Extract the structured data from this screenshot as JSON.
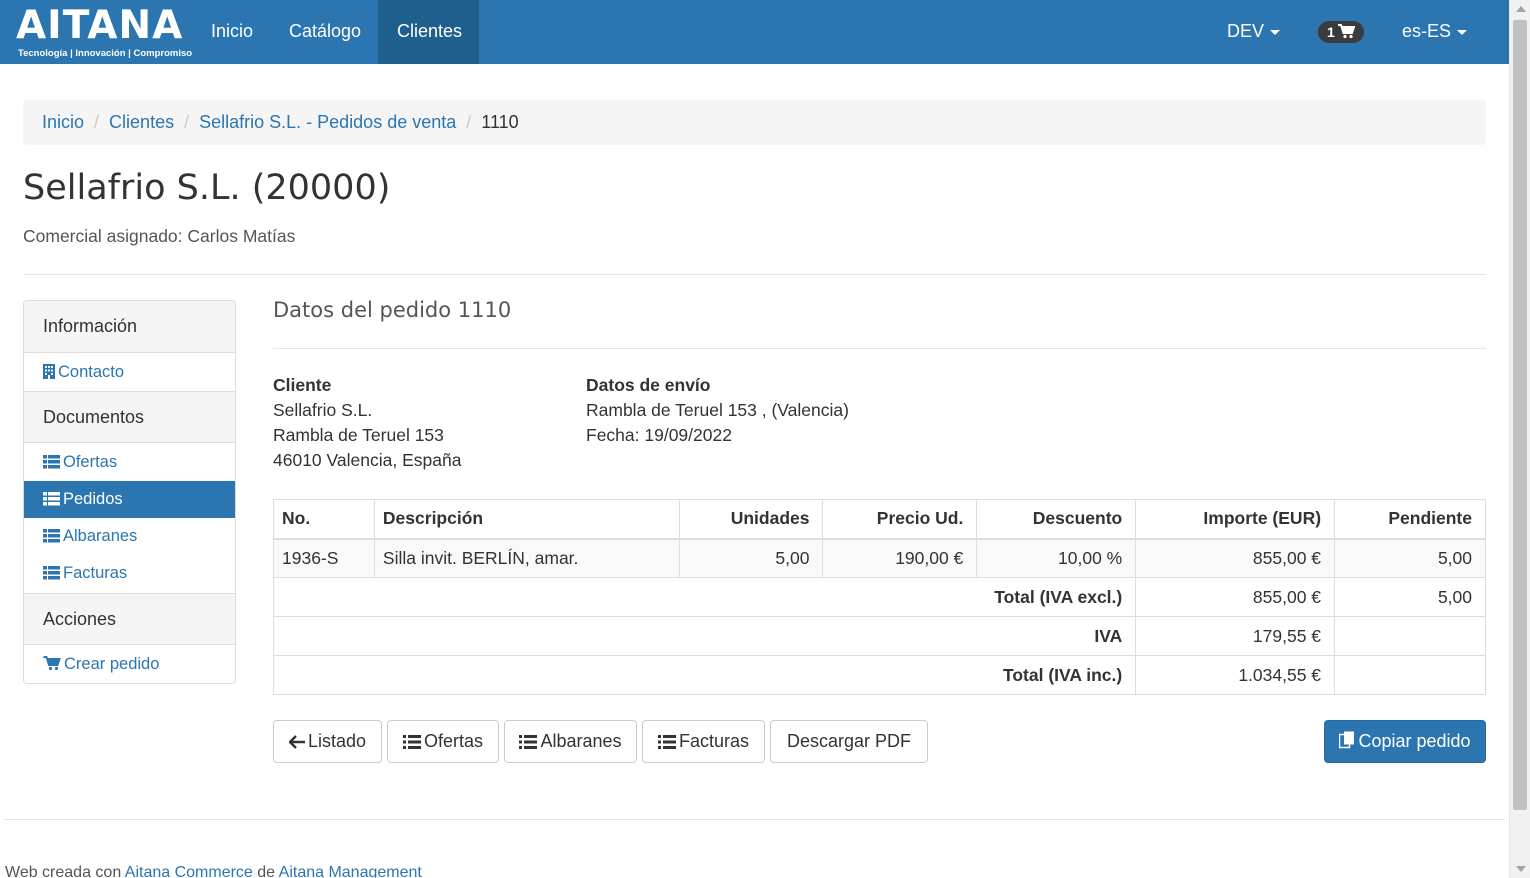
{
  "navbar": {
    "logo_text": "AITANA",
    "logo_tagline": "Tecnología | Innovación | Compromiso",
    "links": [
      "Inicio",
      "Catálogo",
      "Clientes"
    ],
    "active_link": "Clientes",
    "environment": "DEV",
    "cart_count": "1",
    "language": "es-ES"
  },
  "breadcrumb": {
    "items": [
      "Inicio",
      "Clientes",
      "Sellafrio S.L. - Pedidos de venta"
    ],
    "current": "1110"
  },
  "page": {
    "title": "Sellafrio S.L. (20000)",
    "assigned": "Comercial asignado: Carlos Matías"
  },
  "sidebar": {
    "info_header": "Información",
    "contact": "Contacto",
    "docs_header": "Documentos",
    "offers": "Ofertas",
    "orders": "Pedidos",
    "delivery_notes": "Albaranes",
    "invoices": "Facturas",
    "actions_header": "Acciones",
    "create_order": "Crear pedido"
  },
  "order": {
    "section_title": "Datos del pedido 1110",
    "customer_label": "Cliente",
    "customer_name": "Sellafrio S.L.",
    "customer_street": "Rambla de Teruel 153",
    "customer_city": "46010 Valencia, España",
    "shipping_label": "Datos de envío",
    "shipping_address": "Rambla de Teruel 153 , (Valencia)",
    "shipping_date": "Fecha: 19/09/2022"
  },
  "table": {
    "headers": [
      "No.",
      "Descripción",
      "Unidades",
      "Precio Ud.",
      "Descuento",
      "Importe (EUR)",
      "Pendiente"
    ],
    "rows": [
      {
        "no": "1936-S",
        "desc": "Silla invit. BERLÍN, amar.",
        "units": "5,00",
        "price": "190,00 €",
        "discount": "10,00 %",
        "amount": "855,00 €",
        "pending": "5,00"
      }
    ],
    "total_excl_label": "Total (IVA excl.)",
    "total_excl": "855,00 €",
    "total_excl_pending": "5,00",
    "vat_label": "IVA",
    "vat": "179,55 €",
    "total_inc_label": "Total (IVA inc.)",
    "total_inc": "1.034,55 €"
  },
  "buttons": {
    "list": "Listado",
    "offers": "Ofertas",
    "delivery_notes": "Albaranes",
    "invoices": "Facturas",
    "pdf": "Descargar PDF",
    "copy": "Copiar pedido"
  },
  "footer": {
    "prefix": "Web creada con ",
    "link1": "Aitana Commerce",
    "middle": " de ",
    "link2": "Aitana Management"
  },
  "colors": {
    "brand": "#2b76b0",
    "nav_active": "#1e5f8e"
  }
}
